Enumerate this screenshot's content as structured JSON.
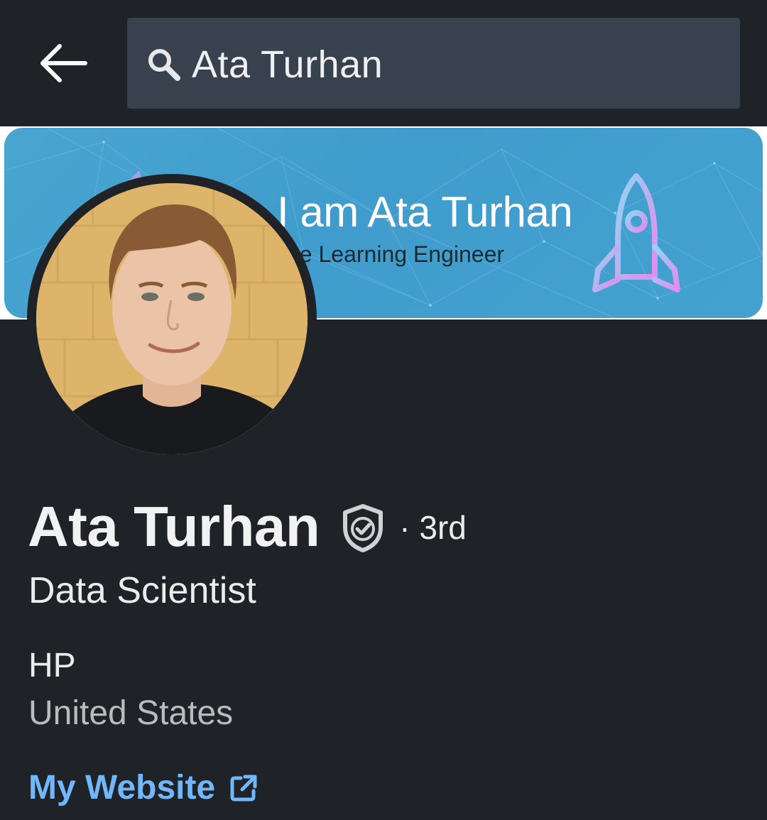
{
  "search": {
    "query": "Ata Turhan"
  },
  "banner": {
    "title": "I am Ata Turhan",
    "subtitle": "ne Learning Engineer"
  },
  "profile": {
    "name": "Ata Turhan",
    "degree": "· 3rd",
    "headline": "Data Scientist",
    "company": "HP",
    "location": "United States",
    "website_label": "My Website"
  },
  "icons": {
    "back": "arrow-left-icon",
    "search": "search-icon",
    "verified": "shield-check-icon",
    "external": "external-link-icon",
    "banner_rocket": "rocket-icon"
  },
  "colors": {
    "background": "#1f2226",
    "search_box": "#38424e",
    "banner": "#44a2d0",
    "link": "#71b7fb",
    "muted_text": "#b9bcbf"
  }
}
